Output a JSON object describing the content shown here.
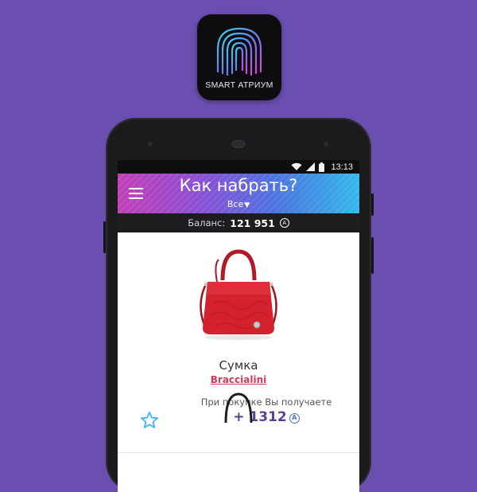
{
  "app_icon": {
    "brand_text": "SMART АТРИУМ"
  },
  "status_bar": {
    "time": "13:13",
    "icons": [
      "wifi-icon",
      "signal-icon",
      "battery-icon"
    ]
  },
  "header": {
    "title": "Как набрать?",
    "filter_label": "Все",
    "menu_icon": "hamburger-menu-icon"
  },
  "balance": {
    "label": "Баланс:",
    "value": "121 951",
    "currency_symbol": "A"
  },
  "product": {
    "name": "Сумка",
    "brand": "Braccialini",
    "reward_text": "При покупке Вы получаете",
    "reward_value": "+ 1312",
    "currency_symbol": "A",
    "favorite_icon": "star-outline-icon"
  },
  "colors": {
    "background": "#6a4fb0",
    "accent_purple": "#5b3f96",
    "brand_link": "#cf3b59",
    "favorite_star": "#4fb8e8"
  }
}
